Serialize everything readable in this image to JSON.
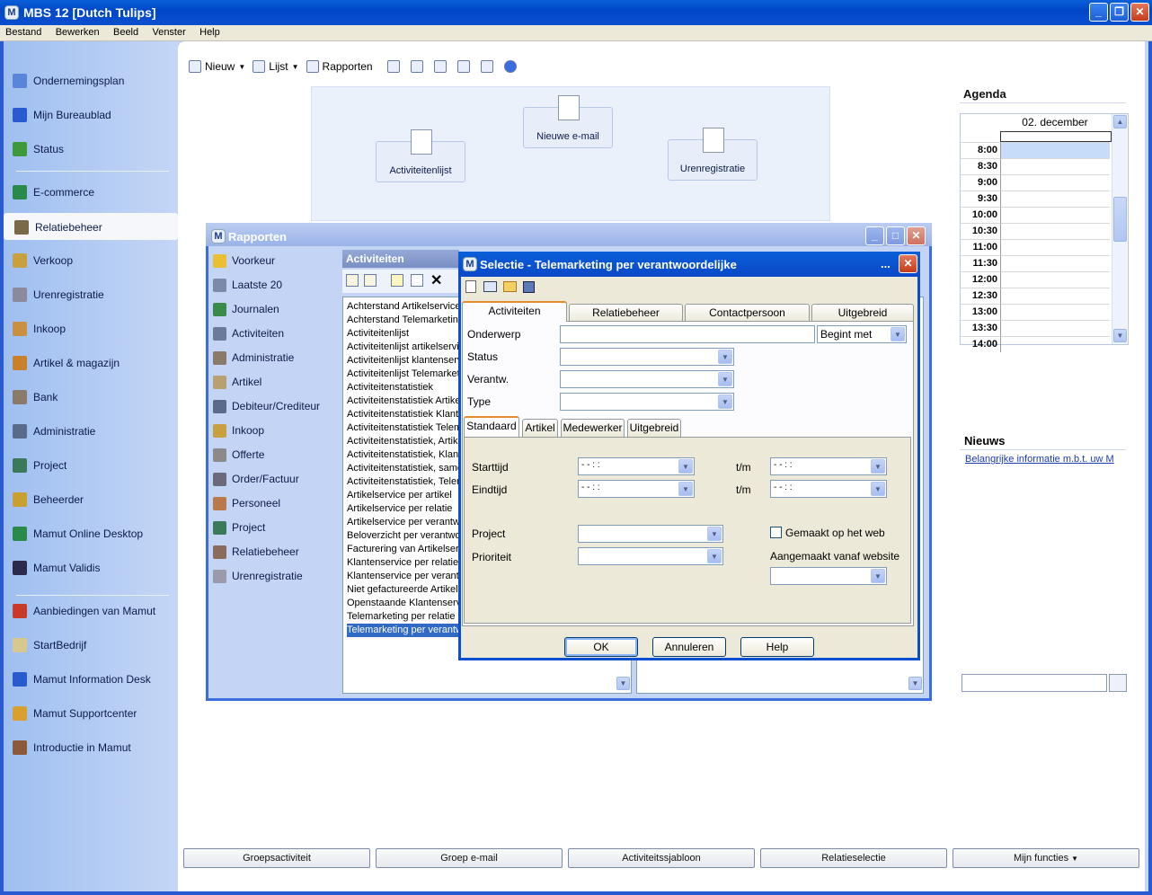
{
  "window": {
    "title": "MBS 12  [Dutch Tulips]",
    "app_icon": "M"
  },
  "menu": [
    "Bestand",
    "Bewerken",
    "Beeld",
    "Venster",
    "Help"
  ],
  "sidebar": {
    "items": [
      {
        "label": "Ondernemingsplan",
        "icon": "plan-icon",
        "color": "#5a86d8"
      },
      {
        "label": "Mijn Bureaublad",
        "icon": "desktop-icon",
        "color": "#2a5ad0"
      },
      {
        "label": "Status",
        "icon": "chart-icon",
        "color": "#3c9a3c"
      },
      {
        "label": "E-commerce",
        "icon": "globe-icon",
        "color": "#2a8a4a"
      },
      {
        "label": "Relatiebeheer",
        "icon": "contacts-icon",
        "color": "#7a6a4a"
      },
      {
        "label": "Verkoop",
        "icon": "sales-icon",
        "color": "#c8a040"
      },
      {
        "label": "Urenregistratie",
        "icon": "hours-icon",
        "color": "#8a8a9a"
      },
      {
        "label": "Inkoop",
        "icon": "purchase-icon",
        "color": "#c89040"
      },
      {
        "label": "Artikel & magazijn",
        "icon": "box-icon",
        "color": "#c8802a"
      },
      {
        "label": "Bank",
        "icon": "bank-icon",
        "color": "#8a7a6a"
      },
      {
        "label": "Administratie",
        "icon": "admin-icon",
        "color": "#5a6a8a"
      },
      {
        "label": "Project",
        "icon": "project-icon",
        "color": "#3a7a5a"
      },
      {
        "label": "Beheerder",
        "icon": "admin-gear-icon",
        "color": "#c8a030"
      },
      {
        "label": "Mamut Online Desktop",
        "icon": "globe-icon",
        "color": "#2a8a4a"
      },
      {
        "label": "Mamut Validis",
        "icon": "validis-icon",
        "color": "#2a2a4a"
      },
      {
        "label": "Aanbiedingen van Mamut",
        "icon": "megaphone-icon",
        "color": "#c83a2a"
      },
      {
        "label": "StartBedrijf",
        "icon": "start-icon",
        "color": "#d8c890"
      },
      {
        "label": "Mamut Information Desk",
        "icon": "info-icon",
        "color": "#2a5ad0"
      },
      {
        "label": "Mamut Supportcenter",
        "icon": "support-icon",
        "color": "#d8a030"
      },
      {
        "label": "Introductie in Mamut",
        "icon": "intro-icon",
        "color": "#8a5a3a"
      }
    ]
  },
  "toolbar": {
    "nieuw": "Nieuw",
    "lijst": "Lijst",
    "rapporten": "Rapporten"
  },
  "flow": {
    "activiteitenlijst": "Activiteitenlijst",
    "nieuwe_email": "Nieuwe e-mail",
    "urenregistratie": "Urenregistratie"
  },
  "agenda": {
    "title": "Agenda",
    "date": "02. december",
    "times": [
      "8:00",
      "8:30",
      "9:00",
      "9:30",
      "10:00",
      "10:30",
      "11:00",
      "11:30",
      "12:00",
      "12:30",
      "13:00",
      "13:30",
      "14:00"
    ]
  },
  "nieuws": {
    "title": "Nieuws",
    "link": "Belangrijke informatie m.b.t. uw M"
  },
  "bottom_buttons": [
    "Groepsactiviteit",
    "Groep e-mail",
    "Activiteitssjabloon",
    "Relatieselectie",
    "Mijn functies"
  ],
  "rapporten": {
    "title": "Rapporten",
    "left": [
      "Voorkeur",
      "Laatste 20",
      "Journalen",
      "Activiteiten",
      "Administratie",
      "Artikel",
      "Debiteur/Crediteur",
      "Inkoop",
      "Offerte",
      "Order/Factuur",
      "Personeel",
      "Project",
      "Relatiebeheer",
      "Urenregistratie"
    ],
    "list_header": "Activiteiten",
    "list": [
      "Achterstand Artikelservice",
      "Achterstand Telemarketing",
      "Activiteitenlijst",
      "Activiteitenlijst artikelservice",
      "Activiteitenlijst klantenservice",
      "Activiteitenlijst Telemarketing",
      "Activiteitenstatistiek",
      "Activiteitenstatistiek Artikel",
      "Activiteitenstatistiek Klanten",
      "Activiteitenstatistiek Telemarketing",
      "Activiteitenstatistiek, Artikel",
      "Activiteitenstatistiek, Klanten",
      "Activiteitenstatistiek, samen",
      "Activiteitenstatistiek, Telem",
      "Artikelservice per artikel",
      "Artikelservice per relatie",
      "Artikelservice per verantwoordelijke",
      "Beloverzicht per verantwoordelijke",
      "Facturering van Artikelservice",
      "Klantenservice per relatie",
      "Klantenservice per verantwoordelijke",
      "Niet gefactureerde Artikelservice",
      "Openstaande Klantenservice",
      "Telemarketing per relatie",
      "Telemarketing per verantwoordelijke"
    ],
    "selected_index": 24
  },
  "selectie": {
    "title": "Selectie - Telemarketing per verantwoordelijke",
    "tabs": [
      "Activiteiten",
      "Relatiebeheer",
      "Contactpersoon",
      "Uitgebreid"
    ],
    "onderwerp": "Onderwerp",
    "begint_met": "Begint met",
    "status": "Status",
    "verantw": "Verantw.",
    "type": "Type",
    "inner_tabs": [
      "Standaard",
      "Artikel",
      "Medewerker",
      "Uitgebreid"
    ],
    "starttijd": "Starttijd",
    "eindtijd": "Eindtijd",
    "tm": "t/m",
    "time_value": "- -      : :",
    "project": "Project",
    "prioriteit": "Prioriteit",
    "gemaakt_web": "Gemaakt op het web",
    "aangemaakt_website": "Aangemaakt vanaf website",
    "ok": "OK",
    "annuleren": "Annuleren",
    "help": "Help",
    "more": "..."
  }
}
